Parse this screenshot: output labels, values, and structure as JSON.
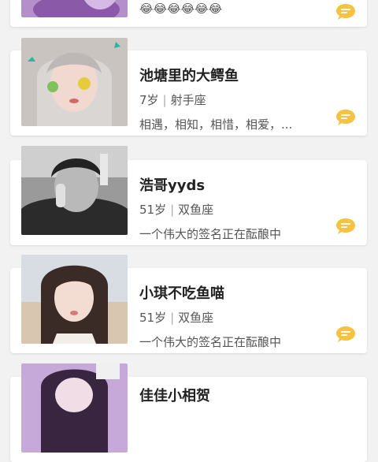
{
  "accent_color": "#f5c242",
  "cards": [
    {
      "name": "",
      "age": "",
      "sign": "",
      "signature": "😂😂😂😂😂😂",
      "photo": "avatar-photo-purple"
    },
    {
      "name": "池塘里的大鳄鱼",
      "age": "7岁",
      "sign": "射手座",
      "signature": "相遇，相知，相惜，相爱，...",
      "photo": "avatar-photo-silver-hair"
    },
    {
      "name": "浩哥yyds",
      "age": "51岁",
      "sign": "双鱼座",
      "signature": "一个伟大的签名正在酝酿中",
      "photo": "avatar-photo-bw-man"
    },
    {
      "name": "小琪不吃鱼喵",
      "age": "51岁",
      "sign": "双鱼座",
      "signature": "一个伟大的签名正在酝酿中",
      "photo": "avatar-photo-girl-beach"
    },
    {
      "name": "佳佳小相贺",
      "age": "",
      "sign": "",
      "signature": "",
      "photo": "avatar-photo-purple"
    }
  ]
}
